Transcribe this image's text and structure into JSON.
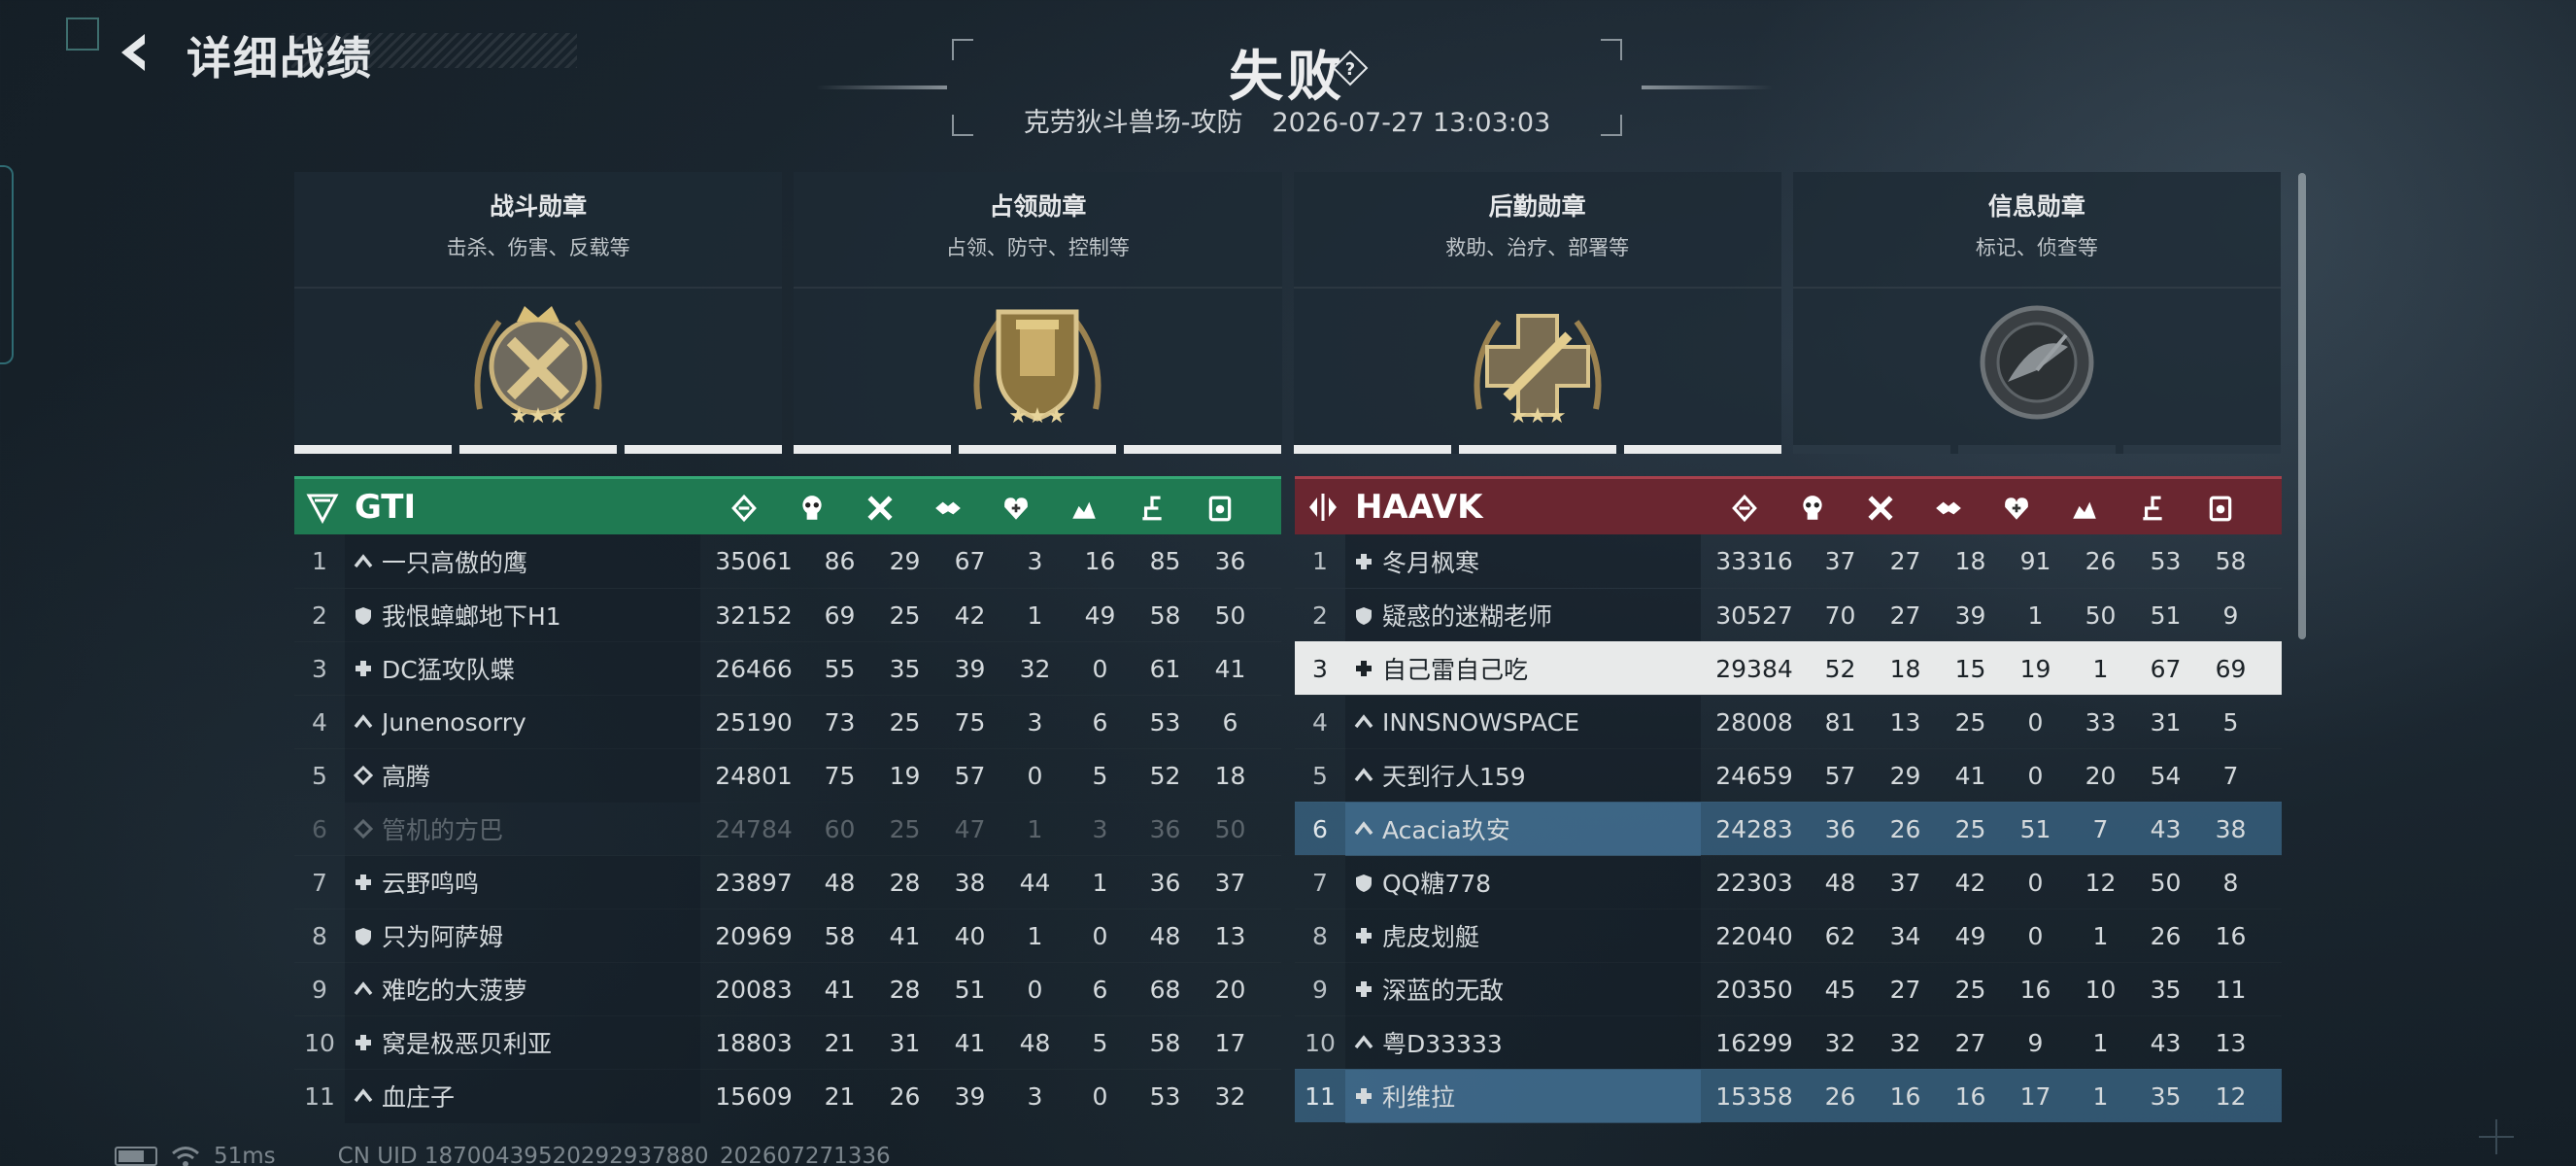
{
  "header": {
    "title": "详细战绩",
    "result": "失败",
    "map_mode": "克劳狄斗兽场-攻防",
    "datetime": "2026-07-27 13:03:03"
  },
  "medals": [
    {
      "name": "战斗勋章",
      "desc": "击杀、伤害、反载等",
      "icon": "combat-medal-icon",
      "bars": "filled"
    },
    {
      "name": "占领勋章",
      "desc": "占领、防守、控制等",
      "icon": "capture-medal-icon",
      "bars": "filled"
    },
    {
      "name": "后勤勋章",
      "desc": "救助、治疗、部署等",
      "icon": "logistics-medal-icon",
      "bars": "filled"
    },
    {
      "name": "信息勋章",
      "desc": "标记、侦查等",
      "icon": "intel-medal-icon",
      "bars": "empty"
    }
  ],
  "columns_icons": [
    "score-icon",
    "kills-icon",
    "deaths-icon",
    "assists-icon",
    "revive-icon",
    "capture-icon",
    "logistics-icon",
    "intel-icon"
  ],
  "team_a": {
    "name": "GTI",
    "color": "#1f7a52",
    "players": [
      {
        "rank": "1",
        "cls": "assault",
        "name": "一只高傲的鹰",
        "score": "35061",
        "stats": [
          "86",
          "29",
          "67",
          "3",
          "16",
          "85",
          "36"
        ]
      },
      {
        "rank": "2",
        "cls": "support",
        "name": "我恨蟑螂地下H1",
        "score": "32152",
        "stats": [
          "69",
          "25",
          "42",
          "1",
          "49",
          "58",
          "50"
        ]
      },
      {
        "rank": "3",
        "cls": "medic",
        "name": "DC猛攻队蝶",
        "score": "26466",
        "stats": [
          "55",
          "35",
          "39",
          "32",
          "0",
          "61",
          "41"
        ]
      },
      {
        "rank": "4",
        "cls": "assault",
        "name": "Junenosorry",
        "score": "25190",
        "stats": [
          "73",
          "25",
          "75",
          "3",
          "6",
          "53",
          "6"
        ]
      },
      {
        "rank": "5",
        "cls": "recon",
        "name": "高腾",
        "score": "24801",
        "stats": [
          "75",
          "19",
          "57",
          "0",
          "5",
          "52",
          "18"
        ]
      },
      {
        "rank": "6",
        "cls": "recon",
        "name": "管机的方巴",
        "score": "24784",
        "stats": [
          "60",
          "25",
          "47",
          "1",
          "3",
          "36",
          "50"
        ],
        "dim": true
      },
      {
        "rank": "7",
        "cls": "medic",
        "name": "云野鸣鸣",
        "score": "23897",
        "stats": [
          "48",
          "28",
          "38",
          "44",
          "1",
          "36",
          "37"
        ]
      },
      {
        "rank": "8",
        "cls": "support",
        "name": "只为阿萨姆",
        "score": "20969",
        "stats": [
          "58",
          "41",
          "40",
          "1",
          "0",
          "48",
          "13"
        ]
      },
      {
        "rank": "9",
        "cls": "assault",
        "name": "难吃的大菠萝",
        "score": "20083",
        "stats": [
          "41",
          "28",
          "51",
          "0",
          "6",
          "68",
          "20"
        ]
      },
      {
        "rank": "10",
        "cls": "medic",
        "name": "窝是极恶贝利亚",
        "score": "18803",
        "stats": [
          "21",
          "31",
          "41",
          "48",
          "5",
          "58",
          "17"
        ]
      },
      {
        "rank": "11",
        "cls": "assault",
        "name": "血庄子",
        "score": "15609",
        "stats": [
          "21",
          "26",
          "39",
          "3",
          "0",
          "53",
          "32"
        ]
      }
    ]
  },
  "team_b": {
    "name": "HAAVK",
    "color": "#6a2630",
    "players": [
      {
        "rank": "1",
        "cls": "medic",
        "name": "冬月枫寒",
        "score": "33316",
        "stats": [
          "37",
          "27",
          "18",
          "91",
          "26",
          "53",
          "58"
        ]
      },
      {
        "rank": "2",
        "cls": "support",
        "name": "疑惑的迷糊老师",
        "score": "30527",
        "stats": [
          "70",
          "27",
          "39",
          "1",
          "50",
          "51",
          "9"
        ]
      },
      {
        "rank": "3",
        "cls": "medic",
        "name": "自己雷自己吃",
        "score": "29384",
        "stats": [
          "52",
          "18",
          "15",
          "19",
          "1",
          "67",
          "69"
        ],
        "me": true
      },
      {
        "rank": "4",
        "cls": "assault",
        "name": "INNSNOWSPACE",
        "score": "28008",
        "stats": [
          "81",
          "13",
          "25",
          "0",
          "33",
          "31",
          "5"
        ]
      },
      {
        "rank": "5",
        "cls": "assault",
        "name": "天到行人159",
        "score": "24659",
        "stats": [
          "57",
          "29",
          "41",
          "0",
          "20",
          "54",
          "7"
        ]
      },
      {
        "rank": "6",
        "cls": "assault",
        "name": "Acacia玖安",
        "score": "24283",
        "stats": [
          "36",
          "26",
          "25",
          "51",
          "7",
          "43",
          "38"
        ],
        "hl": true
      },
      {
        "rank": "7",
        "cls": "support",
        "name": "QQ糖778",
        "score": "22303",
        "stats": [
          "48",
          "37",
          "42",
          "0",
          "12",
          "50",
          "8"
        ]
      },
      {
        "rank": "8",
        "cls": "medic",
        "name": "虎皮划艇",
        "score": "22040",
        "stats": [
          "62",
          "34",
          "49",
          "0",
          "1",
          "26",
          "16"
        ]
      },
      {
        "rank": "9",
        "cls": "medic",
        "name": "深蓝的无敌",
        "score": "20350",
        "stats": [
          "45",
          "27",
          "25",
          "16",
          "10",
          "35",
          "11"
        ]
      },
      {
        "rank": "10",
        "cls": "assault",
        "name": "粤D33333",
        "score": "16299",
        "stats": [
          "32",
          "32",
          "27",
          "9",
          "1",
          "43",
          "13"
        ]
      },
      {
        "rank": "11",
        "cls": "medic",
        "name": "利维拉",
        "score": "15358",
        "stats": [
          "26",
          "16",
          "16",
          "17",
          "1",
          "35",
          "12"
        ],
        "hl": true
      }
    ]
  },
  "footer": {
    "ping": "51ms",
    "uid": "CN UID 18700439520292937880_202607271336"
  }
}
